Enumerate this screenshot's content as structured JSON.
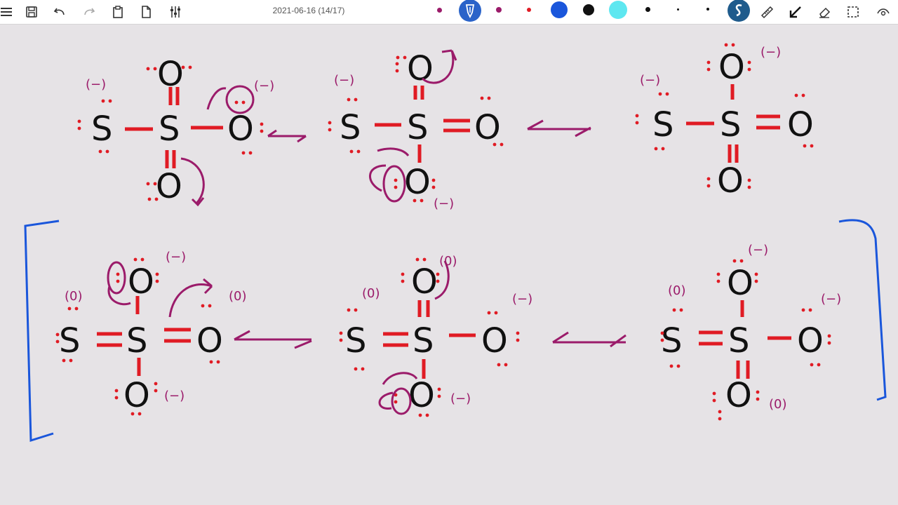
{
  "toolbar": {
    "date_label": "2021-06-16 (14/17)",
    "tools": [
      {
        "name": "menu-icon"
      },
      {
        "name": "save-icon"
      },
      {
        "name": "undo-icon"
      },
      {
        "name": "redo-icon"
      },
      {
        "name": "paste-icon"
      },
      {
        "name": "page-icon"
      },
      {
        "name": "settings-sliders-icon"
      }
    ],
    "palette": [
      "#9b1b6a",
      "#9b1b6a",
      "#e01b24",
      "#1a56db",
      "#111111",
      "#5ee7f0",
      "#111111",
      "#111111",
      "#111111"
    ],
    "right_tools": [
      "text-icon",
      "ruler-icon",
      "select-arrow-icon",
      "eraser-icon",
      "lasso-icon",
      "eye-icon"
    ]
  },
  "canvas": {
    "atoms": {
      "sulfur": "S",
      "oxygen": "O"
    },
    "charges": {
      "minus": "(−)",
      "zero": "(0)"
    }
  }
}
